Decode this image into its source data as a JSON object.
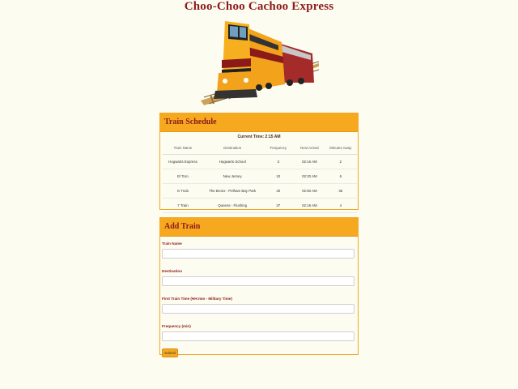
{
  "header": {
    "title": "Choo-Choo Cachoo Express"
  },
  "schedule": {
    "title": "Train Schedule",
    "current_time": "Current Time: 2:15 AM",
    "columns": [
      "Train Name",
      "Destination",
      "Frequency",
      "Next Arrival",
      "Minutes Away"
    ],
    "rows": [
      [
        "Hogwarts Express",
        "Hogwarts School",
        "3",
        "02:16 AM",
        "2"
      ],
      [
        "El Toro",
        "New Jersey",
        "10",
        "02:20 AM",
        "6"
      ],
      [
        "G Train",
        "The Bronx - Pelham Bay Park",
        "40",
        "02:50 AM",
        "36"
      ],
      [
        "7 Train",
        "Queens - Flushing",
        "37",
        "02:18 AM",
        "4"
      ]
    ]
  },
  "add_train": {
    "title": "Add Train",
    "fields": [
      {
        "label": "Train Name",
        "value": ""
      },
      {
        "label": "Destination",
        "value": ""
      },
      {
        "label": "First Train Time (HH:mm - Military Time)",
        "value": ""
      },
      {
        "label": "Frequency (min)",
        "value": ""
      }
    ],
    "submit_label": "Submit"
  },
  "colors": {
    "accent": "#f6a81f",
    "title": "#8b1a1a",
    "background": "#fdfcf0"
  }
}
